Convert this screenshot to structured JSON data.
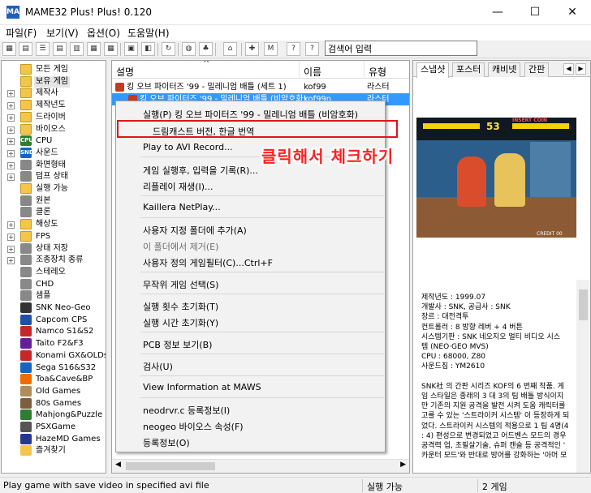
{
  "window": {
    "title": "MAME32 Plus! Plus! 0.120",
    "app_icon_text": "MAME",
    "minimize_glyph": "—",
    "maximize_glyph": "☐",
    "close_glyph": "✕"
  },
  "menubar": {
    "items": [
      "파일(F)",
      "보기(V)",
      "옵션(O)",
      "도움말(H)"
    ]
  },
  "toolbar": {
    "search_placeholder": "검색어 입력"
  },
  "tree": {
    "items": [
      {
        "label": "모든 게임",
        "icon": "folder-icon",
        "expander": ""
      },
      {
        "label": "보유 게임",
        "icon": "folder-icon",
        "expander": "",
        "selected": true
      },
      {
        "label": "제작사",
        "icon": "folder-icon",
        "expander": "+"
      },
      {
        "label": "제작년도",
        "icon": "folder-icon",
        "expander": "+"
      },
      {
        "label": "드라이버",
        "icon": "folder-icon",
        "expander": "+"
      },
      {
        "label": "바이오스",
        "icon": "folder-icon",
        "expander": "+"
      },
      {
        "label": "CPU",
        "icon": "cpu-icon",
        "icon_text": "CPU",
        "expander": "+"
      },
      {
        "label": "사운드",
        "icon": "sound-icon",
        "icon_text": "SND",
        "expander": "+"
      },
      {
        "label": "화면형태",
        "icon": "screen-icon",
        "expander": "+"
      },
      {
        "label": "덤프 상태",
        "icon": "dump-icon",
        "expander": "+"
      },
      {
        "label": "실행 가능",
        "icon": "folder-icon",
        "expander": ""
      },
      {
        "label": "원본",
        "icon": "original-icon",
        "expander": ""
      },
      {
        "label": "클론",
        "icon": "clone-icon",
        "expander": ""
      },
      {
        "label": "해상도",
        "icon": "folder-icon",
        "expander": "+"
      },
      {
        "label": "FPS",
        "icon": "folder-icon",
        "expander": "+"
      },
      {
        "label": "상태 저장",
        "icon": "save-state-icon",
        "expander": "+"
      },
      {
        "label": "조종장치 종류",
        "icon": "controller-icon",
        "expander": "+"
      },
      {
        "label": "스테레오",
        "icon": "stereo-icon",
        "expander": ""
      },
      {
        "label": "CHD",
        "icon": "chd-icon",
        "expander": ""
      },
      {
        "label": "샘플",
        "icon": "sample-icon",
        "expander": ""
      },
      {
        "label": "SNK Neo-Geo",
        "icon": "neogeo-icon",
        "expander": ""
      },
      {
        "label": "Capcom CPS",
        "icon": "capcom-icon",
        "expander": ""
      },
      {
        "label": "Namco S1&S2",
        "icon": "namco-icon",
        "expander": ""
      },
      {
        "label": "Taito F2&F3",
        "icon": "taito-icon",
        "expander": ""
      },
      {
        "label": "Konami GX&OLDs",
        "icon": "konami-icon",
        "expander": ""
      },
      {
        "label": "Sega S16&S32",
        "icon": "sega-icon",
        "expander": ""
      },
      {
        "label": "Toa&Cave&BP",
        "icon": "toa-icon",
        "expander": ""
      },
      {
        "label": "Old Games",
        "icon": "old-games-icon",
        "expander": ""
      },
      {
        "label": "80s Games",
        "icon": "80s-games-icon",
        "expander": ""
      },
      {
        "label": "Mahjong&Puzzle",
        "icon": "mahjong-icon",
        "expander": ""
      },
      {
        "label": "PSXGame",
        "icon": "psx-icon",
        "expander": ""
      },
      {
        "label": "HazeMD Games",
        "icon": "hazemd-icon",
        "expander": ""
      },
      {
        "label": "즐겨찾기",
        "icon": "favorites-icon",
        "expander": ""
      }
    ]
  },
  "list": {
    "headers": {
      "description": "설명",
      "name": "이름",
      "type": "유형"
    },
    "rows": [
      {
        "description": "킹 오브 파이터즈 '99 - 밀레니엄 배틀 (세트 1)",
        "name": "kof99",
        "type": "라스터"
      },
      {
        "description": "킹 오브 파이터즈 '99 - 밀레니엄 배틀 (비암호화)",
        "name": "kof99n",
        "type": "라스터",
        "selected": true
      }
    ]
  },
  "context_menu": {
    "items": [
      "실행(P) 킹 오브 파이터즈 '99 - 밀레니엄 배틀 (비암호화)",
      "드림캐스트 버전, 한글 번역",
      "Play to AVI Record...",
      "게임 실행후, 입력을 기록(R)...",
      "리플레이 재생(I)...",
      "Kaillera NetPlay...",
      "사용자 지정 폴더에 추가(A)",
      "이 폴더에서 제거(E)",
      "사용자 정의 게임필터(C)...Ctrl+F",
      "무작위 게임 선택(S)",
      "실행 횟수 초기화(T)",
      "실행 시간 초기화(Y)",
      "PCB 정보 보기(B)",
      "검사(U)",
      "View Information at MAWS",
      "neodrvr.c 등록정보(I)",
      "neogeo 바이오스 속성(F)",
      "등록정보(O)"
    ],
    "annotation": "클릭해서 체크하기"
  },
  "right_panel": {
    "tabs": [
      "스냅샷",
      "포스터",
      "캐비넷",
      "간판"
    ],
    "arrows": [
      "◀",
      "▶"
    ],
    "screenshot_hud": {
      "timer": "53",
      "insert_coin": "INSERT COIN",
      "credit": "CREDIT 00"
    },
    "info_lines": [
      "제작년도 : 1999.07",
      "개발사 : SNK, 공급사 : SNK",
      "장르 : 대전격투",
      "컨트롤러 : 8 방향 레버 + 4 버튼",
      "시스템기판 : SNK 네오지오 멀티 비디오 시스",
      "템 (NEO·GEO MVS)",
      "CPU : 68000, Z80",
      "사운드칩 : YM2610",
      "",
      "SNK社 의 간판 시리즈 KOF의 6 번째 작품. 게",
      "임 스타일은 종래의 3 대 3의 팀 배틀 방식이지",
      "만 기존의 지원 공격을 발전 시켜 도움 캐릭터를",
      "고를 수 있는 '스트라이커 시스템' 이 등장하게 되",
      "었다. 스트라이커 시스템의 적용으로 1 팀 4명(4",
      ": 4) 편성으로 변경되었고 어드벤스 모드의 경우",
      "공격력 업, 초필살기술, 슈퍼 캔슬 등 공격적인 '",
      "카운터 모드'와 반대로 방어를 강화하는 '아머 모"
    ]
  },
  "statusbar": {
    "message": "Play game with save video in specified avi file",
    "state": "실행 가능",
    "count": "2 게임"
  },
  "colors": {
    "selection": "#3399ff",
    "highlight_border": "#e0141a",
    "annotation_text": "#ff2020",
    "folder": "#f2c54b"
  }
}
